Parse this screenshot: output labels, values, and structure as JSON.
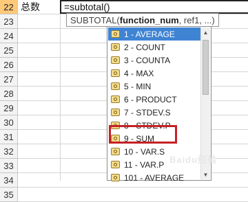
{
  "sheet": {
    "row_numbers": [
      "22",
      "23",
      "24",
      "25",
      "26",
      "27",
      "28",
      "29",
      "30",
      "31",
      "32",
      "33",
      "34",
      "35"
    ],
    "cell_a22": "总数",
    "cell_b22": "=subtotal()"
  },
  "tooltip": {
    "func": "SUBTOTAL(",
    "param_bold": "function_num",
    "rest": ", ref1, ...)"
  },
  "dropdown": {
    "items": [
      "1 - AVERAGE",
      "2 - COUNT",
      "3 - COUNTA",
      "4 - MAX",
      "5 - MIN",
      "6 - PRODUCT",
      "7 - STDEV.S",
      "8 - STDEV.P",
      "9 - SUM",
      "10 - VAR.S",
      "11 - VAR.P",
      "101 - AVERAGE"
    ],
    "selected_index": 0,
    "highlighted_item": "9 - SUM"
  },
  "colors": {
    "active_row_header": "#ffc97a",
    "selection": "#3f84d3",
    "highlight_box": "#c52125"
  },
  "watermark": "Baidu经验"
}
